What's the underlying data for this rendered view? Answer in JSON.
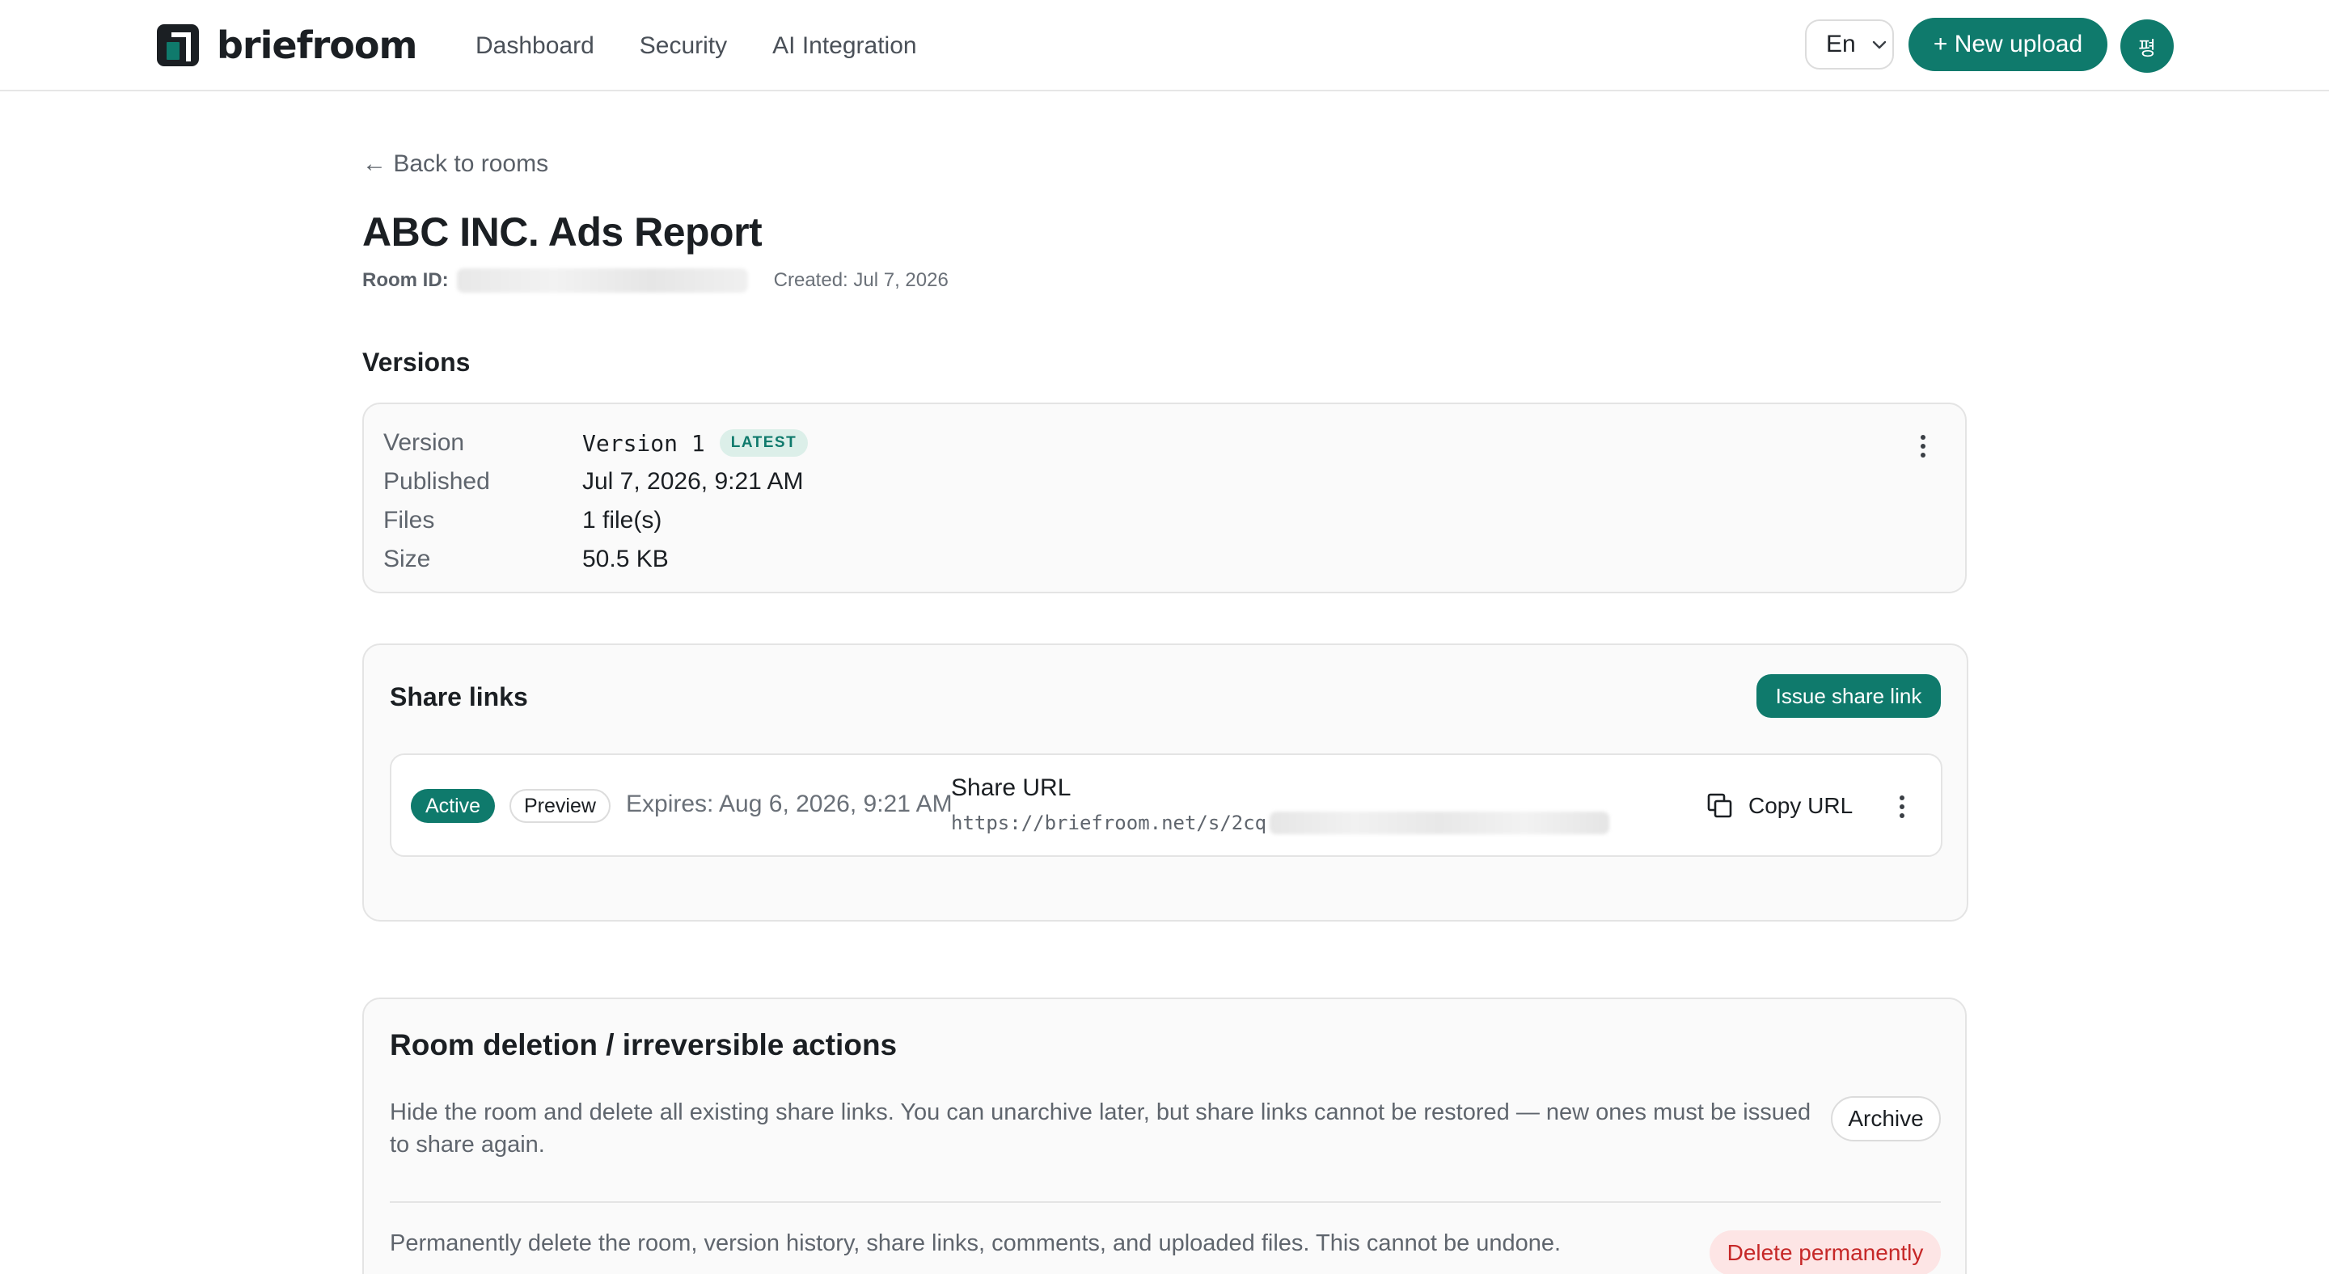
{
  "app": {
    "brand": "briefroom",
    "nav": [
      "Dashboard",
      "Security",
      "AI Integration"
    ],
    "language": "En",
    "new_upload_label": "+ New upload",
    "avatar_glyph": "평",
    "accent_color": "#0f7a6c"
  },
  "room": {
    "back_label": "← Back to rooms",
    "title": "ABC INC. Ads Report",
    "room_id_label": "Room ID:",
    "created": "Created: Jul 7, 2026"
  },
  "versions": {
    "heading": "Versions",
    "rows": [
      {
        "key": "Version",
        "value": "Version 1"
      },
      {
        "key": "Published",
        "value": "Jul 7, 2026, 9:21 AM"
      },
      {
        "key": "Files",
        "value": "1 file(s)"
      },
      {
        "key": "Size",
        "value": "50.5 KB"
      }
    ],
    "latest_badge": "LATEST"
  },
  "share": {
    "heading": "Share links",
    "issue_label": "Issue share link",
    "link": {
      "status": "Active",
      "mode": "Preview",
      "expires": "Expires: Aug 6, 2026, 9:21 AM",
      "url_label": "Share URL",
      "url_prefix": "https://briefroom.net/s/2cq",
      "copy_label": "Copy URL"
    }
  },
  "danger": {
    "heading": "Room deletion / irreversible actions",
    "archive_text": "Hide the room and delete all existing share links. You can unarchive later, but share links cannot be restored — new ones must be issued to share again.",
    "archive_label": "Archive",
    "delete_text": "Permanently delete the room, version history, share links, comments, and uploaded files. This cannot be undone.",
    "delete_label": "Delete permanently"
  }
}
